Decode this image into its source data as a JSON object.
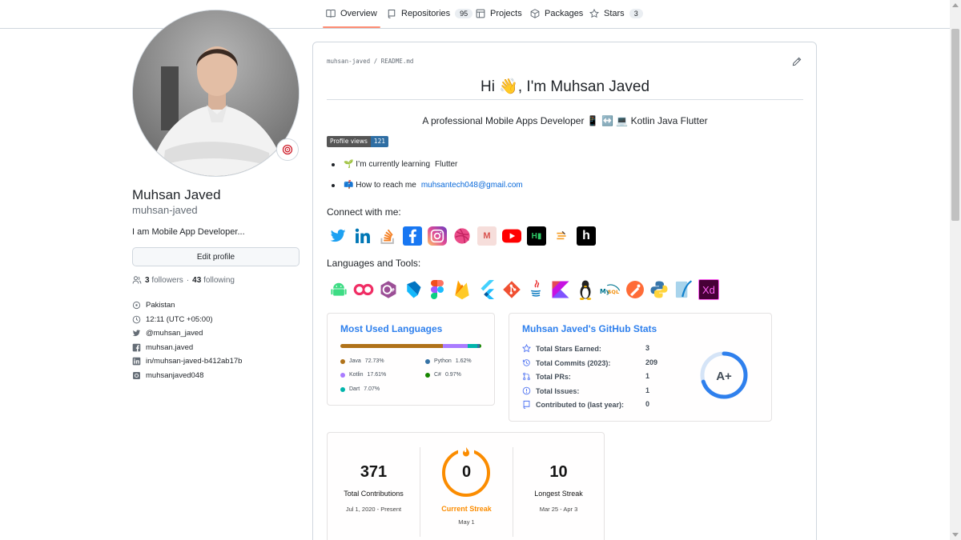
{
  "nav": {
    "tabs": [
      {
        "label": "Overview",
        "icon": "book-icon"
      },
      {
        "label": "Repositories",
        "count": "95",
        "icon": "repo-icon"
      },
      {
        "label": "Projects",
        "icon": "table-icon"
      },
      {
        "label": "Packages",
        "icon": "package-icon"
      },
      {
        "label": "Stars",
        "count": "3",
        "icon": "star-icon"
      }
    ]
  },
  "profile": {
    "name": "Muhsan Javed",
    "login": "muhsan-javed",
    "bio": "I am Mobile App Developer...",
    "edit_label": "Edit profile",
    "followers_count": "3",
    "followers_label": "followers",
    "separator": "·",
    "following_count": "43",
    "following_label": "following",
    "details": [
      {
        "icon": "location-icon",
        "text": "Pakistan"
      },
      {
        "icon": "clock-icon",
        "text": "12:11 (UTC +05:00)"
      },
      {
        "icon": "twitter-icon",
        "text": "@muhsan_javed"
      },
      {
        "icon": "facebook-icon",
        "text": "muhsan.javed"
      },
      {
        "icon": "linkedin-icon",
        "text": "in/muhsan-javed-b412ab17b"
      },
      {
        "icon": "instagram-icon",
        "text": "muhsanjaved048"
      }
    ]
  },
  "readme": {
    "path": "muhsan-javed / README.md",
    "title": "Hi 👋, I'm Muhsan Javed",
    "subtitle": "A professional Mobile Apps Developer 📱 ↔️ 💻 Kotlin Java Flutter",
    "badge_label": "Profile views",
    "badge_value": "121",
    "bullet1_prefix": "🌱 I’m currently learning",
    "bullet1_emphasis": "Flutter",
    "bullet2_prefix": "📫 How to reach me",
    "bullet2_link": "muhsantech048@gmail.com",
    "connect_heading": "Connect with me:",
    "tools_heading": "Languages and Tools:",
    "social_icons": [
      "twitter",
      "linkedin",
      "stackoverflow",
      "facebook",
      "instagram",
      "dribbble",
      "medium",
      "youtube",
      "hackerearth",
      "codechef",
      "hashnode"
    ],
    "tool_icons": [
      "android",
      "appwrite",
      "csharp",
      "dart",
      "figma",
      "firebase",
      "flutter",
      "git",
      "java",
      "kotlin",
      "linux",
      "mysql",
      "postman",
      "python",
      "sqlite",
      "xd"
    ]
  },
  "langs_card": {
    "title": "Most Used Languages",
    "langs": [
      {
        "name": "Java",
        "pct": "72.73%",
        "color": "#b07219",
        "value": 72.73
      },
      {
        "name": "Kotlin",
        "pct": "17.61%",
        "color": "#A97BFF",
        "value": 17.61
      },
      {
        "name": "Dart",
        "pct": "7.07%",
        "color": "#00B4AB",
        "value": 7.07
      },
      {
        "name": "Python",
        "pct": "1.62%",
        "color": "#3572A5",
        "value": 1.62
      },
      {
        "name": "C#",
        "pct": "0.97%",
        "color": "#178600",
        "value": 0.97
      }
    ]
  },
  "stats_card": {
    "title": "Muhsan Javed's GitHub Stats",
    "rows": [
      {
        "label": "Total Stars Earned:",
        "value": "3",
        "icon": "star-icon"
      },
      {
        "label": "Total Commits (2023):",
        "value": "209",
        "icon": "history-icon"
      },
      {
        "label": "Total PRs:",
        "value": "1",
        "icon": "pull-request-icon"
      },
      {
        "label": "Total Issues:",
        "value": "1",
        "icon": "issue-icon"
      },
      {
        "label": "Contributed to (last year):",
        "value": "0",
        "icon": "repo-icon"
      }
    ],
    "grade": "A+",
    "grade_progress": 0.7
  },
  "streak_card": {
    "total_value": "371",
    "total_label": "Total Contributions",
    "total_range": "Jul 1, 2020 - Present",
    "current_value": "0",
    "current_label": "Current Streak",
    "current_date": "May 1",
    "longest_value": "10",
    "longest_label": "Longest Streak",
    "longest_range": "Mar 25 - Apr 3"
  },
  "colors": {
    "accent_link": "#0969da",
    "stats_title": "#2f80ed",
    "streak_orange": "#fb8c00",
    "tab_underline": "#fd8c73"
  }
}
